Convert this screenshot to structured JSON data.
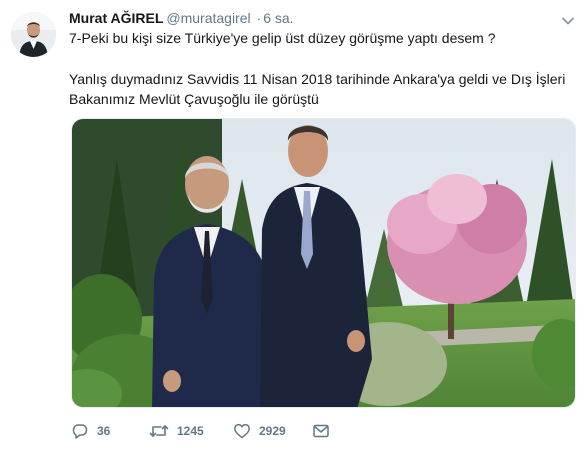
{
  "tweet": {
    "author_name": "Murat AĞIREL",
    "author_handle": "@muratagirel",
    "separator": "·",
    "time": "6 sa.",
    "line1": "7-Peki bu kişi size Türkiye'ye gelip üst düzey görüşme yaptı desem ?",
    "line2": "Yanlış duymadınız Savvidis 11 Nisan 2018 tarihinde Ankara'ya geldi ve Dış İşleri",
    "line3": "Bakanımız Mevlüt Çavuşoğlu ile görüştü"
  },
  "actions": {
    "reply_count": "36",
    "retweet_count": "1245",
    "like_count": "2929"
  },
  "icons": {
    "reply": "reply-icon",
    "retweet": "retweet-icon",
    "like": "heart-icon",
    "message": "envelope-icon",
    "menu": "chevron-down-icon"
  },
  "colors": {
    "text": "#14171a",
    "muted": "#657786",
    "border": "#e6ecf0"
  }
}
